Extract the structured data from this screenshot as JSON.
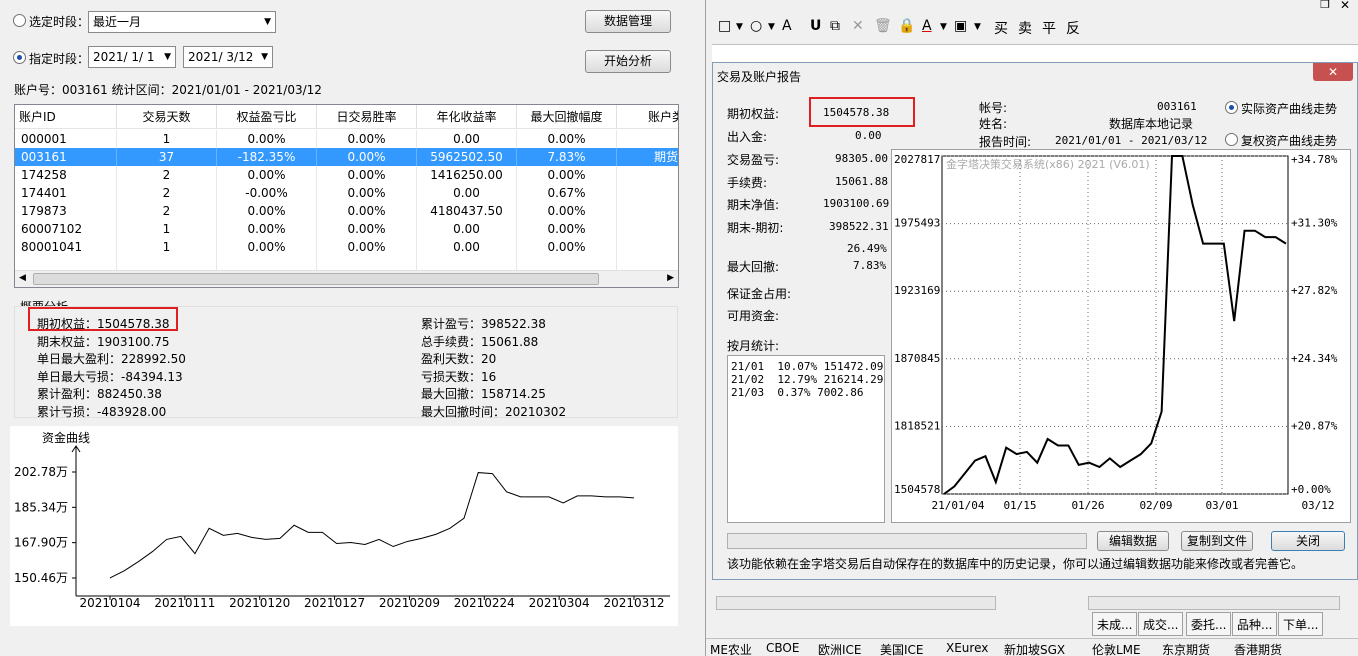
{
  "left": {
    "period_select_label": "选定时段：",
    "period_select_value": "最近一月",
    "period_custom_label": "指定时段：",
    "date_from": "2021/ 1/ 1",
    "date_to": "2021/ 3/12",
    "btn_data_manage": "数据管理",
    "btn_start": "开始分析",
    "account_line": "账户号：003161   统计区间：2021/01/01 - 2021/03/12",
    "grid": {
      "columns": [
        "账户ID",
        "交易天数",
        "权益盈亏比",
        "日交易胜率",
        "年化收益率",
        "最大回撤幅度",
        "账户类"
      ],
      "rows": [
        [
          "000001",
          "1",
          "0.00%",
          "0.00%",
          "0.00",
          "0.00%",
          ""
        ],
        [
          "003161",
          "37",
          "-182.35%",
          "0.00%",
          "5962502.50",
          "7.83%",
          "期货"
        ],
        [
          "174258",
          "2",
          "0.00%",
          "0.00%",
          "1416250.00",
          "0.00%",
          ""
        ],
        [
          "174401",
          "2",
          "-0.00%",
          "0.00%",
          "0.00",
          "0.67%",
          ""
        ],
        [
          "179873",
          "2",
          "0.00%",
          "0.00%",
          "4180437.50",
          "0.00%",
          ""
        ],
        [
          "60007102",
          "1",
          "0.00%",
          "0.00%",
          "0.00",
          "0.00%",
          ""
        ],
        [
          "80001041",
          "1",
          "0.00%",
          "0.00%",
          "0.00",
          "0.00%",
          ""
        ]
      ]
    },
    "summary": {
      "title": "概要分析",
      "left_items": [
        "期初权益：1504578.38",
        "期末权益：1903100.75",
        "单日最大盈利：228992.50",
        "单日最大亏损：-84394.13",
        "累计盈利：882450.38",
        "累计亏损：-483928.00"
      ],
      "right_items": [
        "累计盈亏：398522.38",
        "总手续费：15061.88",
        "盈利天数：20",
        "亏损天数：16",
        "最大回撤：158714.25",
        "最大回撤时间：20210302"
      ]
    }
  },
  "chart_data": [
    {
      "type": "line",
      "title": "资金曲线",
      "y_ticks": [
        "202.78万",
        "185.34万",
        "167.90万",
        "150.46万"
      ],
      "x_ticks": [
        "20210104",
        "20210111",
        "20210120",
        "20210127",
        "20210209",
        "20210224",
        "20210304",
        "20210312"
      ],
      "ylim": [
        150.46,
        202.78
      ],
      "values": [
        150.5,
        154.0,
        158.5,
        163.5,
        169.5,
        171.0,
        162.5,
        175.0,
        171.5,
        172.5,
        170.5,
        169.5,
        170.0,
        176.5,
        173.0,
        173.0,
        167.5,
        168.0,
        167.0,
        169.5,
        166.0,
        168.5,
        170.0,
        172.0,
        175.0,
        180.0,
        202.5,
        202.0,
        193.0,
        190.5,
        190.5,
        190.5,
        187.5,
        191.0,
        191.0,
        190.5,
        190.5,
        190.0
      ]
    },
    {
      "type": "line",
      "title": "金字塔决策交易系统(x86) 2021 (V6.01)",
      "y_left_ticks": [
        "2027817",
        "1975493",
        "1923169",
        "1870845",
        "1818521",
        "1504578"
      ],
      "y_right_ticks": [
        "+34.78%",
        "+31.30%",
        "+27.82%",
        "+24.34%",
        "+20.87%",
        "+0.00%"
      ],
      "x_ticks": [
        "21/01/04",
        "01/15",
        "01/26",
        "02/09",
        "03/01",
        "03/12"
      ],
      "values": [
        1504578,
        1540000,
        1600000,
        1660000,
        1680000,
        1560000,
        1720000,
        1690000,
        1700000,
        1650000,
        1760000,
        1730000,
        1730000,
        1640000,
        1650000,
        1630000,
        1670000,
        1630000,
        1660000,
        1690000,
        1740000,
        1830000,
        2028000,
        2028000,
        1990000,
        1960000,
        1960000,
        1960000,
        1900000,
        1970000,
        1970000,
        1965000,
        1965000,
        1960000
      ]
    }
  ],
  "right": {
    "title": "交易及账户报告",
    "toolbar_items": [
      "□",
      "○",
      "A",
      "U",
      "买",
      "卖",
      "平",
      "反"
    ],
    "labels": {
      "init_equity": "期初权益:",
      "in_out": "出入金:",
      "trade_pl": "交易盈亏:",
      "fee": "手续费:",
      "end_net": "期末净值:",
      "end_minus_init": "期末-期初:",
      "max_drawdown": "最大回撤:",
      "margin_used": "保证金占用:",
      "available": "可用资金:",
      "monthly": "按月统计:",
      "account": "帐号:",
      "name": "姓名:",
      "report_time": "报告时间:"
    },
    "values": {
      "init_equity": "1504578.38",
      "in_out": "0.00",
      "trade_pl": "98305.00",
      "fee": "15061.88",
      "end_net": "1903100.69",
      "end_minus_init": "398522.31",
      "end_pct": "26.49%",
      "max_drawdown": "7.83%",
      "account": "003161",
      "name": "数据库本地记录",
      "report_time": "2021/01/01 - 2021/03/12"
    },
    "monthly_rows": [
      "21/01  10.07% 151472.09",
      "21/02  12.79% 216214.29",
      "21/03  0.37% 7002.86"
    ],
    "radio_real": "实际资产曲线走势",
    "radio_compound": "复权资产曲线走势",
    "btn_edit": "编辑数据",
    "btn_copy": "复制到文件",
    "btn_close": "关闭",
    "note": "该功能依赖在金字塔交易后自动保存在的数据库中的历史记录，你可以通过编辑数据功能来修改或者完善它。"
  },
  "bottom_tabs": [
    "未成...",
    "成交...",
    "委托...",
    "品种...",
    "下单..."
  ],
  "exchanges": [
    "ME农业",
    "CBOE",
    "欧洲ICE",
    "美国ICE",
    "XEurex",
    "新加坡SGX",
    "伦敦LME",
    "东京期货",
    "香港期货"
  ]
}
